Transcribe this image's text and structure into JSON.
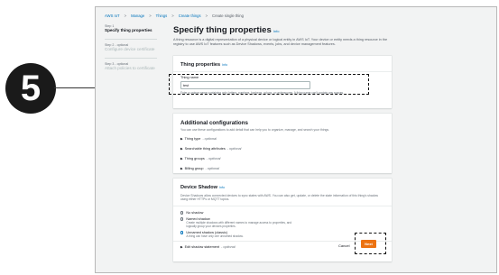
{
  "callout": {
    "number": "5"
  },
  "breadcrumb": [
    "AWS IoT",
    "Manage",
    "Things",
    "Create things",
    "Create single thing"
  ],
  "steps": [
    {
      "num": "Step 1",
      "name": "Specify thing properties",
      "active": true
    },
    {
      "num": "Step 2 - optional",
      "name": "Configure device certificate",
      "active": false
    },
    {
      "num": "Step 3 - optional",
      "name": "Attach policies to certificate",
      "active": false
    }
  ],
  "page": {
    "title": "Specify thing properties",
    "info": "Info",
    "description": "A thing resource is a digital representation of a physical device or logical entity in AWS IoT. Your device or entity needs a thing resource in the registry to use AWS IoT features such as Device Shadows, events, jobs, and device management features."
  },
  "thing_properties": {
    "title": "Thing properties",
    "info": "Info",
    "name_label": "Thing name",
    "name_value": "test",
    "name_help": "Enter a unique name containing only: letters, numbers, hyphens, colons, or underscores. A thing name can't contain any spaces."
  },
  "additional": {
    "title": "Additional configurations",
    "description": "You can use these configurations to add detail that can help you to organize, manage, and search your things.",
    "items": [
      {
        "label": "Thing type",
        "suffix": "- optional"
      },
      {
        "label": "Searchable thing attributes",
        "suffix": "- optional"
      },
      {
        "label": "Thing groups",
        "suffix": "- optional"
      },
      {
        "label": "Billing group",
        "suffix": "- optional"
      }
    ]
  },
  "shadow": {
    "title": "Device Shadow",
    "info": "Info",
    "description": "Device Shadows allow connected devices to sync states with AWS. You can also get, update, or delete the state information of this thing's shadow using either HTTPs or MQTT topics.",
    "options": [
      {
        "label": "No shadow",
        "desc": "",
        "selected": false
      },
      {
        "label": "Named shadow",
        "desc": "Create multiple shadows with different names to manage access to properties, and logically group your devices properties.",
        "selected": false
      },
      {
        "label": "Unnamed shadow (classic)",
        "desc": "A thing can have only one unnamed shadow.",
        "selected": true
      }
    ],
    "edit_label": "Edit shadow statement",
    "edit_suffix": "- optional"
  },
  "footer": {
    "cancel": "Cancel",
    "next": "Next"
  },
  "colors": {
    "accent": "#0073bb",
    "primary_button": "#ec7211",
    "callout": "#1a1a1a"
  }
}
